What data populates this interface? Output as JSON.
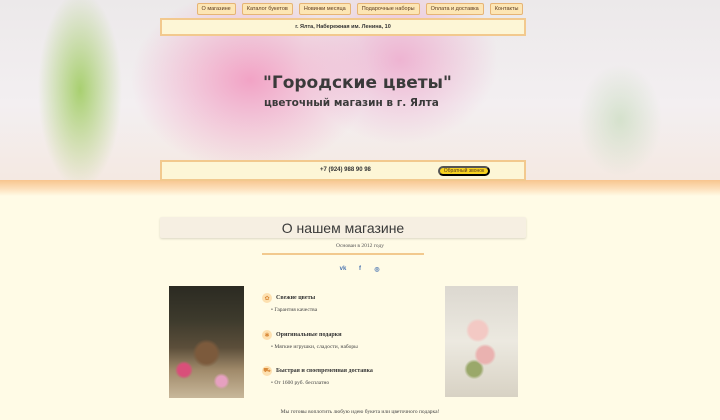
{
  "nav": [
    {
      "label": "О магазине"
    },
    {
      "label": "Каталог букетов"
    },
    {
      "label": "Новинки месяца"
    },
    {
      "label": "Подарочные наборы"
    },
    {
      "label": "Оплата и доставка"
    },
    {
      "label": "Контакты"
    }
  ],
  "header": {
    "address": "г. Ялта, Набережная им. Ленина, 10",
    "title": "\"Городские цветы\"",
    "subtitle": "цветочный магазин в г. Ялта",
    "phone": "+7 (924) 988 90 98",
    "callback_label": "Обратный звонок"
  },
  "about": {
    "heading": "О нашем магазине",
    "founded": "Основан в 2012 году",
    "socials": [
      {
        "icon": "vk-icon",
        "glyph": "vk"
      },
      {
        "icon": "facebook-icon",
        "glyph": "f"
      },
      {
        "icon": "instagram-icon",
        "glyph": "◎"
      }
    ],
    "features": [
      {
        "icon": "flower-icon",
        "glyph": "✿",
        "title": "Свежие цветы",
        "item": "Гарантия качества"
      },
      {
        "icon": "gift-icon",
        "glyph": "✱",
        "title": "Оригинальные подарки",
        "item": "Мягкие игрушки, сладости, наборы"
      },
      {
        "icon": "delivery-icon",
        "glyph": "⛟",
        "title": "Быстрая и своевременная доставка",
        "item": "От 1600 руб. бесплатно"
      }
    ],
    "bottom_text": "Мы готовы воплотить любую идею букета или цветочного подарка!"
  },
  "colors": {
    "accent": "#f2c98e",
    "button": "#f7d21f",
    "background": "#fffbe6"
  }
}
